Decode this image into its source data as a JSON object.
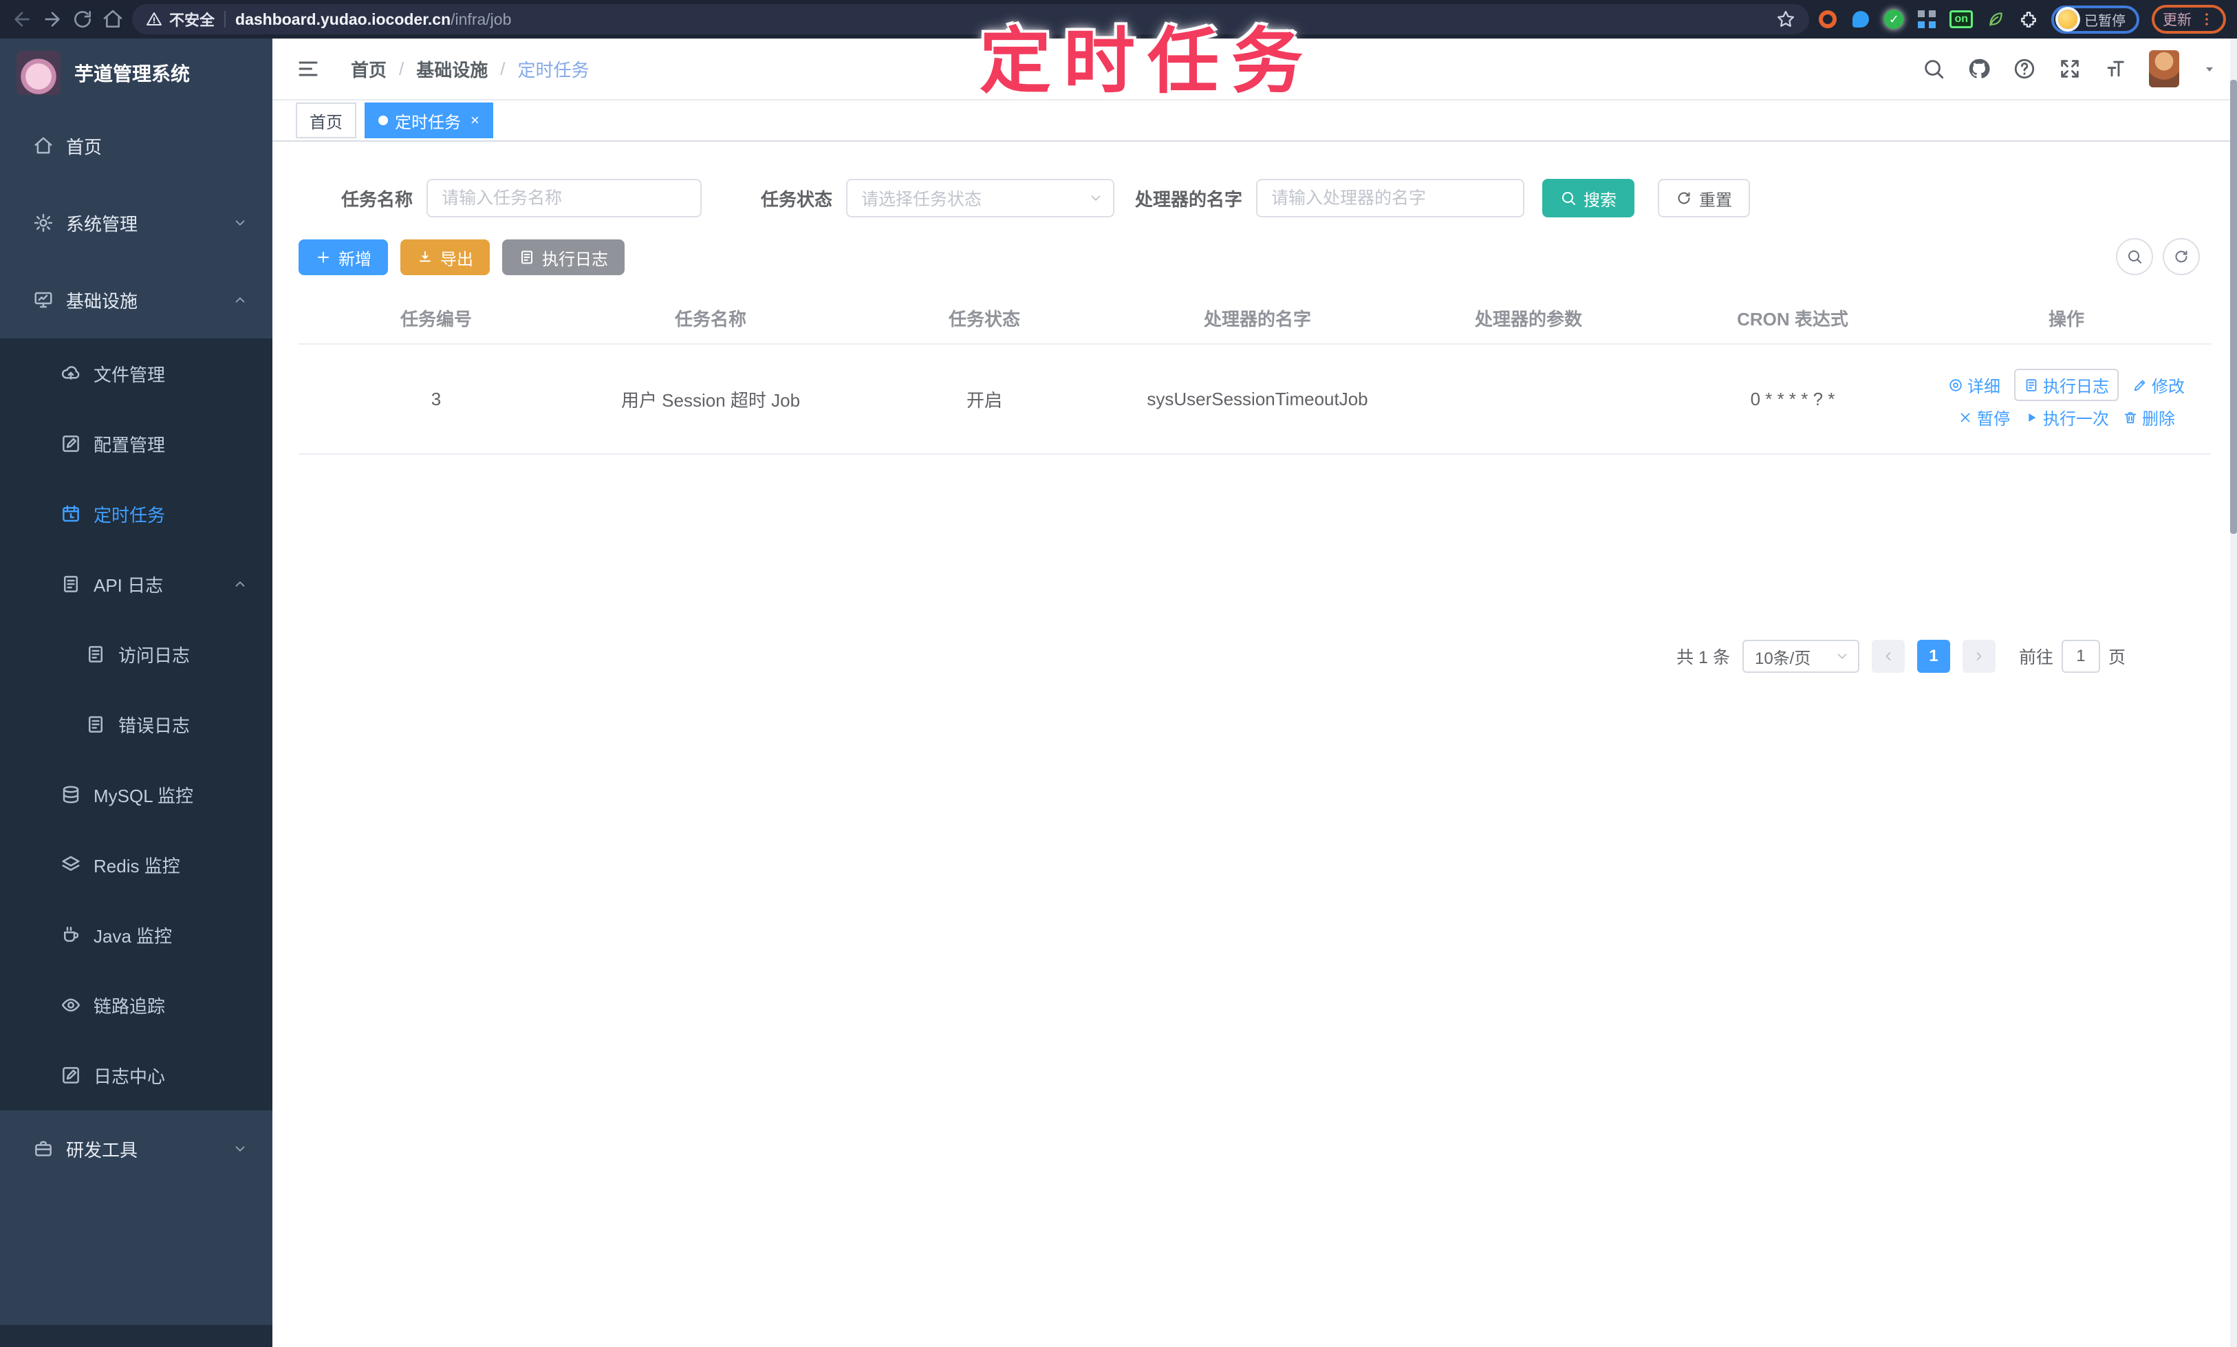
{
  "browser": {
    "security_label": "不安全",
    "url_host": "dashboard.yudao.iocoder.cn",
    "url_path": "/infra/job",
    "extension_badge": "on",
    "extension_green_check": "✓",
    "profile_paused_label": "已暂停",
    "update_button": "更新",
    "icons": [
      "back-arrow",
      "forward-arrow",
      "reload",
      "home",
      "warning-triangle",
      "bookmark-star",
      "extension-orange",
      "extension-blue",
      "extension-green-check",
      "extension-grid",
      "extension-on-badge",
      "extension-leaf",
      "extensions-puzzle",
      "profile-avatar",
      "menu-dots-vertical"
    ]
  },
  "overlay": {
    "title": "定时任务",
    "color": "#f23b5d"
  },
  "sidebar": {
    "logo_title": "芋道管理系统",
    "items": [
      {
        "label": "首页",
        "icon": "home-icon",
        "level": 1
      },
      {
        "label": "系统管理",
        "icon": "gear-icon",
        "level": 1,
        "chevron": "down"
      },
      {
        "label": "基础设施",
        "icon": "monitor-icon",
        "level": 1,
        "chevron": "up",
        "expanded": true
      },
      {
        "label": "文件管理",
        "icon": "cloud-upload-icon",
        "level": 2
      },
      {
        "label": "配置管理",
        "icon": "edit-square-icon",
        "level": 2
      },
      {
        "label": "定时任务",
        "icon": "timer-icon",
        "level": 2,
        "active": true
      },
      {
        "label": "API 日志",
        "icon": "document-icon",
        "level": 2,
        "chevron": "up",
        "expanded": true
      },
      {
        "label": "访问日志",
        "icon": "document-icon",
        "level": 3
      },
      {
        "label": "错误日志",
        "icon": "document-icon",
        "level": 3
      },
      {
        "label": "MySQL 监控",
        "icon": "database-icon",
        "level": 2
      },
      {
        "label": "Redis 监控",
        "icon": "layers-icon",
        "level": 2
      },
      {
        "label": "Java 监控",
        "icon": "coffee-icon",
        "level": 2
      },
      {
        "label": "链路追踪",
        "icon": "eye-icon",
        "level": 2
      },
      {
        "label": "日志中心",
        "icon": "log-edit-icon",
        "level": 2
      },
      {
        "label": "研发工具",
        "icon": "briefcase-icon",
        "level": 1,
        "chevron": "down"
      }
    ]
  },
  "header": {
    "breadcrumb": [
      "首页",
      "基础设施",
      "定时任务"
    ],
    "separator": "/",
    "icons": [
      "search-icon",
      "github-icon",
      "question-icon",
      "fullscreen-icon",
      "font-size-icon",
      "user-avatar",
      "caret-down-icon"
    ]
  },
  "tabs": [
    {
      "label": "首页",
      "active": false
    },
    {
      "label": "定时任务",
      "active": true,
      "closable": true,
      "close_glyph": "×"
    }
  ],
  "filter": {
    "name_label": "任务名称",
    "name_placeholder": "请输入任务名称",
    "status_label": "任务状态",
    "status_placeholder": "请选择任务状态",
    "handler_label": "处理器的名字",
    "handler_placeholder": "请输入处理器的名字",
    "search_button": "搜索",
    "reset_button": "重置"
  },
  "toolbar": {
    "add_button": "新增",
    "export_button": "导出",
    "exec_log_button": "执行日志"
  },
  "table": {
    "columns": [
      "任务编号",
      "任务名称",
      "任务状态",
      "处理器的名字",
      "处理器的参数",
      "CRON 表达式",
      "操作"
    ],
    "rows": [
      {
        "id": "3",
        "name": "用户 Session 超时 Job",
        "status": "开启",
        "handler": "sysUserSessionTimeoutJob",
        "param": "",
        "cron": "0 * * * * ? *",
        "actions": {
          "detail": "详细",
          "exec_log": "执行日志",
          "edit": "修改",
          "pause": "暂停",
          "run_once": "执行一次",
          "delete": "删除"
        }
      }
    ]
  },
  "pagination": {
    "total": "共 1 条",
    "page_size": "10条/页",
    "current_page": "1",
    "goto_label": "前往",
    "goto_value": "1",
    "page_unit": "页"
  },
  "colors": {
    "primary": "#409eff",
    "warning": "#e6a23c",
    "info": "#909399",
    "search_teal": "#2cb6a3",
    "sidebar_bg": "#304156",
    "submenu_bg": "#1f2d3d",
    "overlay_pink": "#f23b5d",
    "browser_bar": "#1d2434"
  }
}
